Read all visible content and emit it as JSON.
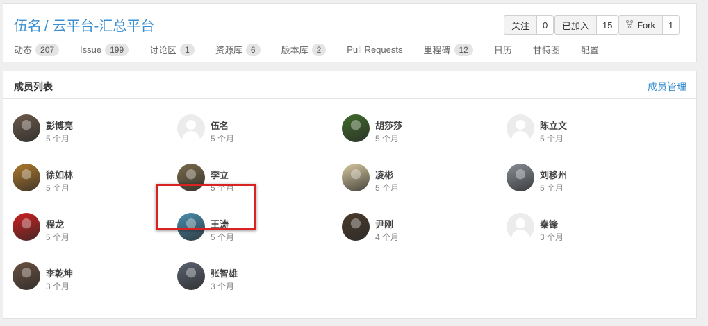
{
  "header": {
    "owner": "伍名",
    "separator": "/",
    "project": "云平台-汇总平台",
    "watch": {
      "label": "关注",
      "count": "0"
    },
    "joined": {
      "label": "已加入",
      "count": "15"
    },
    "fork": {
      "label": "Fork",
      "count": "1",
      "icon": "fork-icon"
    }
  },
  "tabs": [
    {
      "label": "动态",
      "count": "207"
    },
    {
      "label": "Issue",
      "count": "199"
    },
    {
      "label": "讨论区",
      "count": "1"
    },
    {
      "label": "资源库",
      "count": "6"
    },
    {
      "label": "版本库",
      "count": "2"
    },
    {
      "label": "Pull Requests",
      "count": ""
    },
    {
      "label": "里程碑",
      "count": "12"
    },
    {
      "label": "日历",
      "count": ""
    },
    {
      "label": "甘特图",
      "count": ""
    },
    {
      "label": "配置",
      "count": ""
    }
  ],
  "members": {
    "title": "成员列表",
    "manage_label": "成员管理",
    "list": [
      {
        "name": "彭博亮",
        "time": "5 个月",
        "avatar": "photo",
        "color": "#6b5a4a"
      },
      {
        "name": "伍名",
        "time": "5 个月",
        "avatar": "placeholder",
        "color": "#ececec"
      },
      {
        "name": "胡莎莎",
        "time": "5 个月",
        "avatar": "photo",
        "color": "#3f6b2a"
      },
      {
        "name": "陈立文",
        "time": "5 个月",
        "avatar": "placeholder",
        "color": "#ececec"
      },
      {
        "name": "徐如林",
        "time": "5 个月",
        "avatar": "photo",
        "color": "#b07a2a"
      },
      {
        "name": "李立",
        "time": "5 个月",
        "avatar": "photo",
        "color": "#7a6a4a"
      },
      {
        "name": "凌彬",
        "time": "5 个月",
        "avatar": "photo",
        "color": "#d8c9a0"
      },
      {
        "name": "刘移州",
        "time": "5 个月",
        "avatar": "photo",
        "color": "#8a8f96"
      },
      {
        "name": "程龙",
        "time": "5 个月",
        "avatar": "photo",
        "color": "#cf1f1f"
      },
      {
        "name": "王涛",
        "time": "5 个月",
        "avatar": "photo",
        "color": "#4a8fb0"
      },
      {
        "name": "尹刚",
        "time": "4 个月",
        "avatar": "photo",
        "color": "#4a3a2a"
      },
      {
        "name": "秦锋",
        "time": "3 个月",
        "avatar": "placeholder",
        "color": "#ececec"
      },
      {
        "name": "李乾坤",
        "time": "3 个月",
        "avatar": "photo",
        "color": "#6a5040"
      },
      {
        "name": "张智雄",
        "time": "3 个月",
        "avatar": "photo",
        "color": "#5a6270"
      }
    ]
  }
}
